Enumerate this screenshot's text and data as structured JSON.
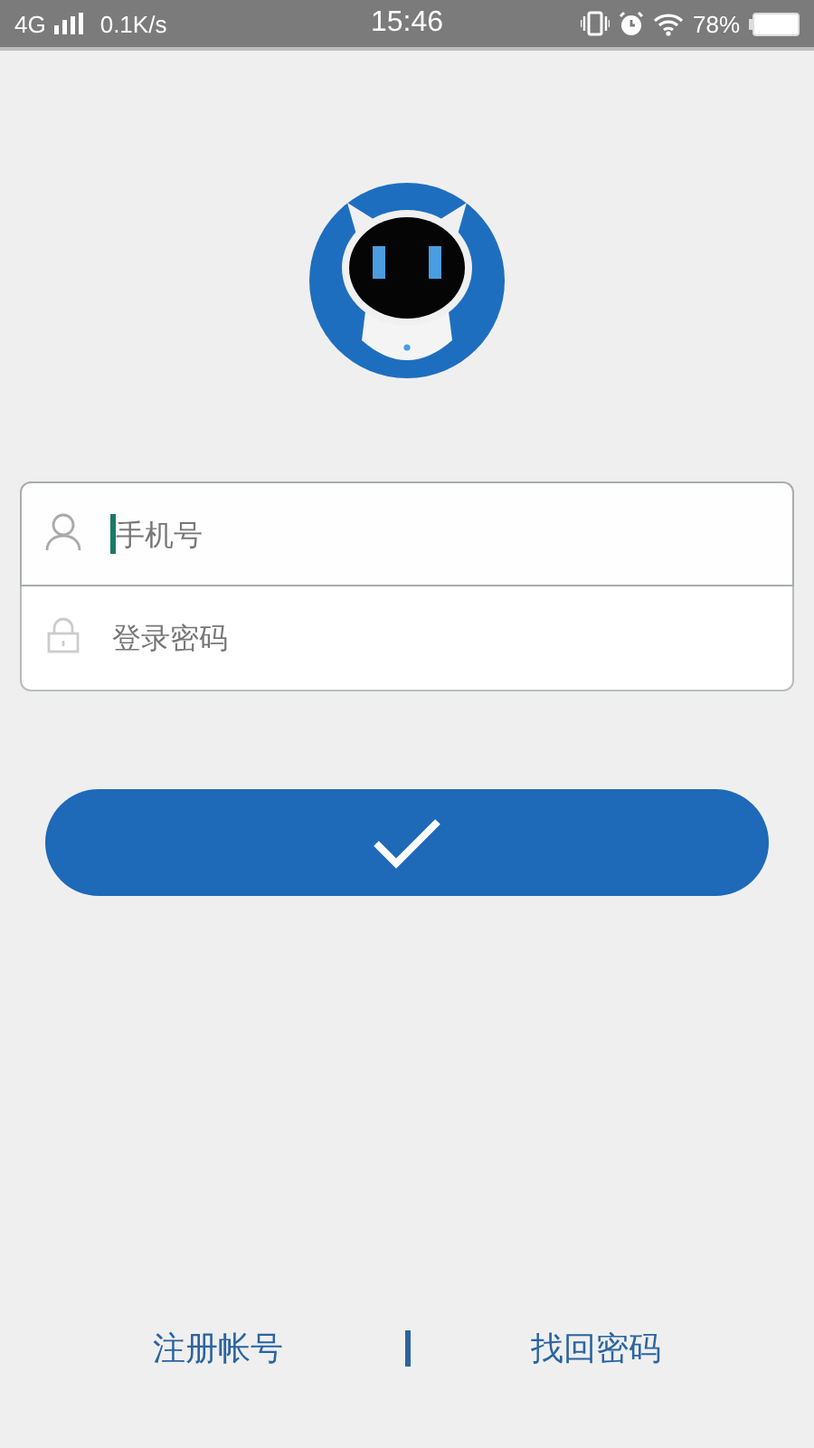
{
  "status_bar": {
    "network": "4G",
    "speed": "0.1K/s",
    "time": "15:46",
    "battery": "78%"
  },
  "login_form": {
    "fields": [
      {
        "kind": "phone",
        "placeholder": "手机号",
        "focused": true
      },
      {
        "kind": "password",
        "placeholder": "登录密码",
        "focused": false
      }
    ]
  },
  "footer_links": [
    {
      "label": "注册帐号"
    },
    {
      "label": "找回密码"
    }
  ]
}
